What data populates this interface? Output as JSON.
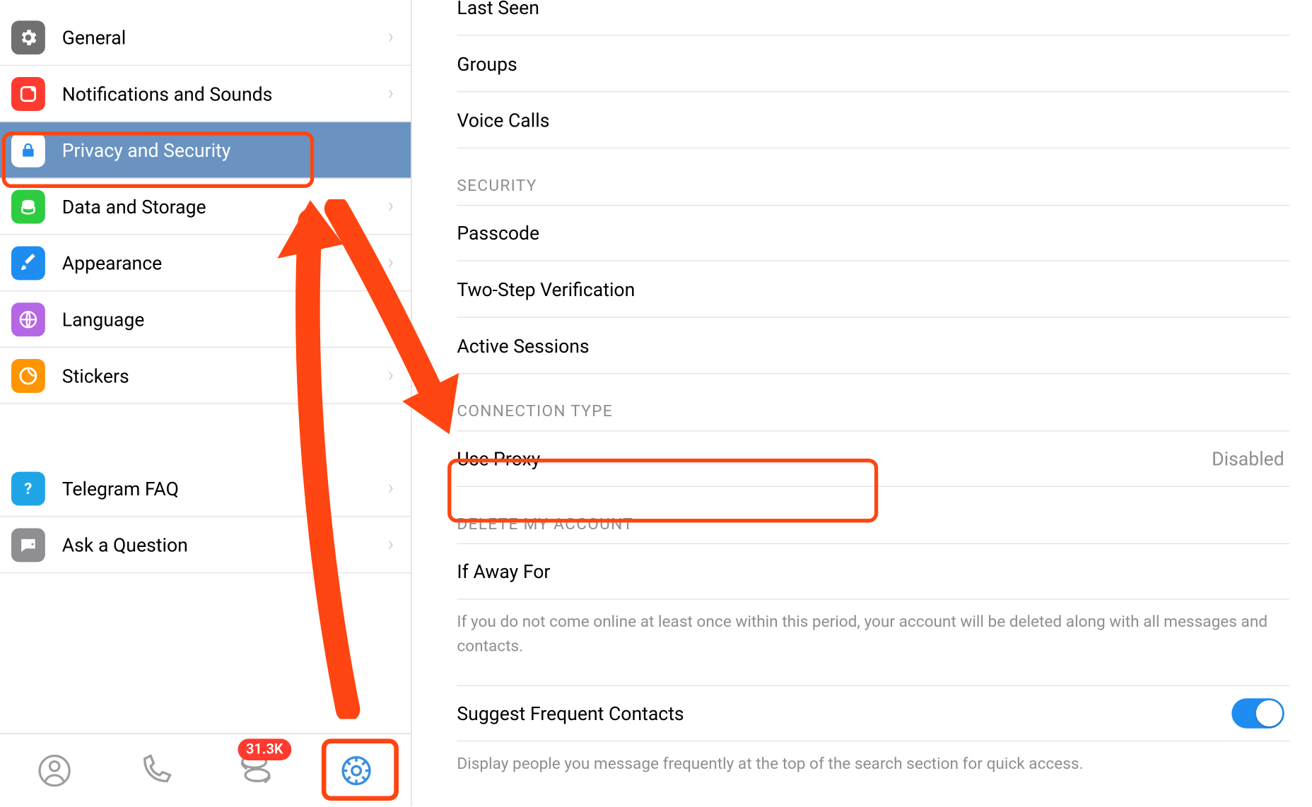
{
  "sidebar": {
    "items": [
      {
        "label": "General",
        "icon": "gear",
        "color": "#707070"
      },
      {
        "label": "Notifications and Sounds",
        "icon": "bell",
        "color": "#ff3b30"
      },
      {
        "label": "Privacy and Security",
        "icon": "lock",
        "color": "#1f8cf0",
        "selected": true
      },
      {
        "label": "Data and Storage",
        "icon": "stack",
        "color": "#2ecc40"
      },
      {
        "label": "Appearance",
        "icon": "brush",
        "color": "#1f8cf0"
      },
      {
        "label": "Language",
        "icon": "globe",
        "color": "#b667e6"
      },
      {
        "label": "Stickers",
        "icon": "sticker",
        "color": "#ff9500"
      }
    ],
    "help_items": [
      {
        "label": "Telegram FAQ",
        "icon": "question",
        "color": "#1fa5e6"
      },
      {
        "label": "Ask a Question",
        "icon": "chat",
        "color": "#8e8e93"
      }
    ]
  },
  "toolbar": {
    "badge": "31.3K"
  },
  "content": {
    "privacy_rows": [
      {
        "label": "Last Seen"
      },
      {
        "label": "Groups"
      },
      {
        "label": "Voice Calls"
      }
    ],
    "security_header": "SECURITY",
    "security_rows": [
      {
        "label": "Passcode"
      },
      {
        "label": "Two-Step Verification"
      },
      {
        "label": "Active Sessions"
      }
    ],
    "connection_header": "CONNECTION TYPE",
    "connection_row": {
      "label": "Use Proxy",
      "value": "Disabled"
    },
    "delete_header": "DELETE MY ACCOUNT",
    "delete_row": {
      "label": "If Away For"
    },
    "delete_info": "If you do not come online at least once within this period, your account will be deleted along with all messages and contacts.",
    "suggest_row": {
      "label": "Suggest Frequent Contacts",
      "toggle": true
    },
    "suggest_info": "Display people you message frequently at the top of the search section for quick access."
  }
}
